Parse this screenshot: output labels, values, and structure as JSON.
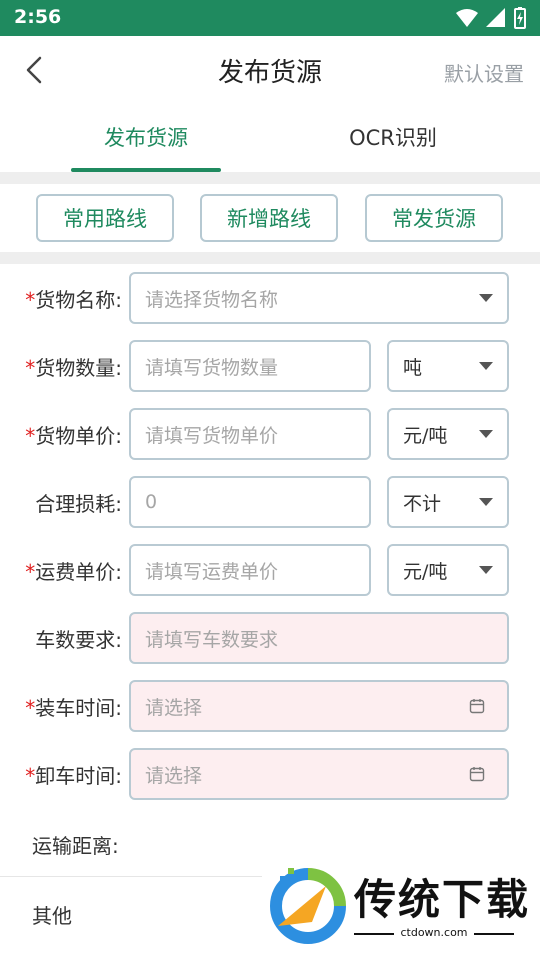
{
  "status_bar": {
    "time": "2:56",
    "wifi_icon": "wifi-icon",
    "signal_icon": "signal-icon",
    "battery_icon": "battery-charging-icon"
  },
  "header": {
    "title": "发布货源",
    "right_action": "默认设置",
    "back_icon": "back-arrow-icon"
  },
  "tabs": [
    {
      "label": "发布货源",
      "active": true
    },
    {
      "label": "OCR识别",
      "active": false
    }
  ],
  "route_buttons": [
    "常用路线",
    "新增路线",
    "常发货源"
  ],
  "form": {
    "cargo_name": {
      "label": "货物名称:",
      "required": "*",
      "placeholder": "请选择货物名称"
    },
    "cargo_quantity": {
      "label": "货物数量:",
      "required": "*",
      "placeholder": "请填写货物数量",
      "unit": "吨"
    },
    "cargo_price": {
      "label": "货物单价:",
      "required": "*",
      "placeholder": "请填写货物单价",
      "unit": "元/吨"
    },
    "loss": {
      "label": "合理损耗:",
      "value": "0",
      "unit": "不计"
    },
    "freight_price": {
      "label": "运费单价:",
      "required": "*",
      "placeholder": "请填写运费单价",
      "unit": "元/吨"
    },
    "truck_count": {
      "label": "车数要求:",
      "placeholder": "请填写车数要求"
    },
    "load_time": {
      "label": "装车时间:",
      "required": "*",
      "placeholder": "请选择"
    },
    "unload_time": {
      "label": "卸车时间:",
      "required": "*",
      "placeholder": "请选择"
    },
    "distance": {
      "label": "运输距离:"
    },
    "other": {
      "label": "其他"
    }
  },
  "watermark": {
    "brand": "传统下载",
    "domain": "ctdown.com"
  },
  "colors": {
    "primary": "#1f8a5f",
    "required": "#e02020",
    "border": "#b9cad3",
    "pink_bg": "#fdeef0"
  }
}
